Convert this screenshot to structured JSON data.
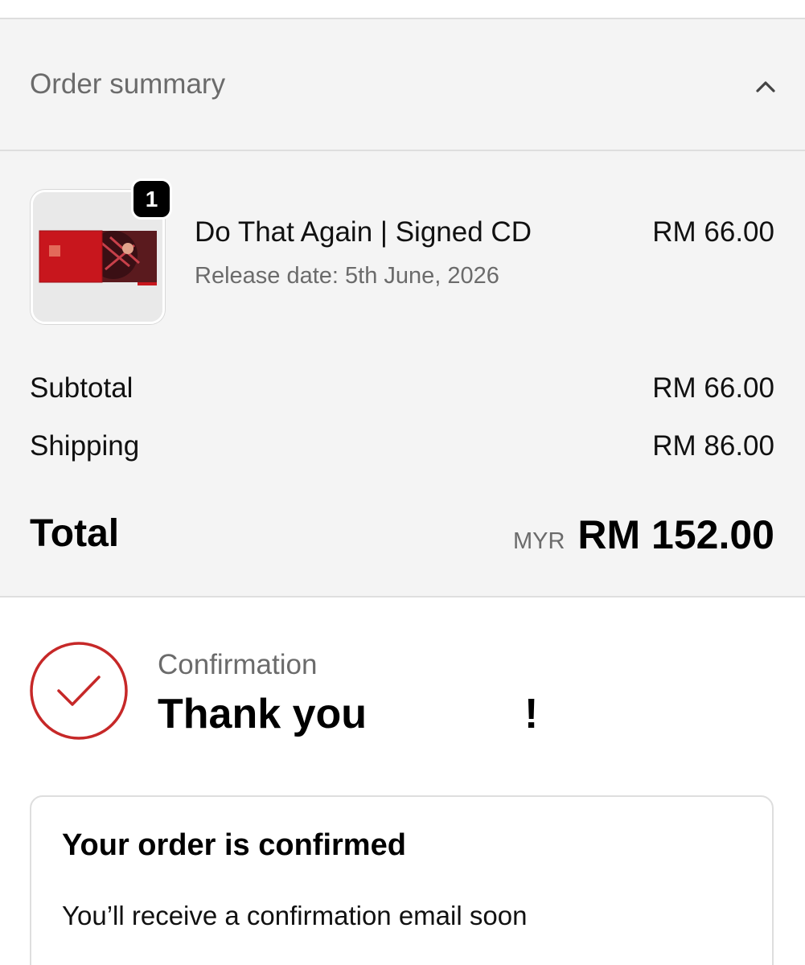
{
  "order_summary": {
    "title": "Order summary",
    "toggle_icon": "chevron-up-icon"
  },
  "item": {
    "quantity": "1",
    "title": "Do That Again | Signed CD",
    "release": "Release date: 5th June, 2026",
    "price": "RM 66.00"
  },
  "totals": {
    "subtotal_label": "Subtotal",
    "subtotal_value": "RM 66.00",
    "shipping_label": "Shipping",
    "shipping_value": "RM 86.00",
    "total_label": "Total",
    "currency": "MYR",
    "total_value": "RM 152.00"
  },
  "confirmation": {
    "label": "Confirmation",
    "heading": "Thank you",
    "heading_end": "!",
    "icon": "check-circle-icon",
    "accent_color": "#c62828"
  },
  "card": {
    "title": "Your order is confirmed",
    "text": "You’ll receive a confirmation email soon"
  }
}
